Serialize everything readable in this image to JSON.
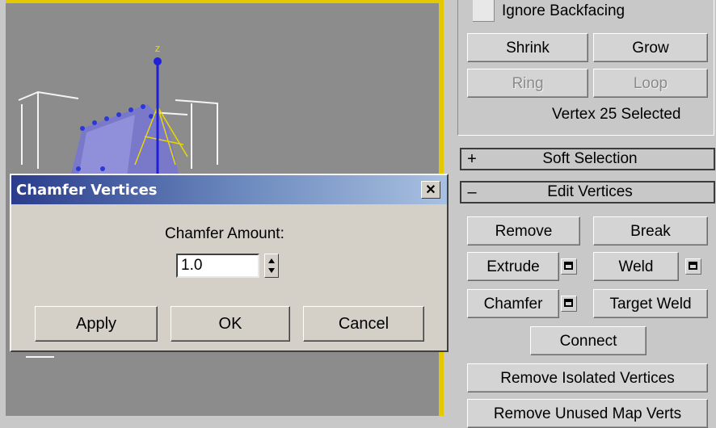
{
  "viewport": {
    "axis_label": "z"
  },
  "panel": {
    "ignore_backfacing_label": "Ignore Backfacing",
    "selection": {
      "shrink": "Shrink",
      "grow": "Grow",
      "ring": "Ring",
      "loop": "Loop",
      "status": "Vertex 25 Selected"
    },
    "rollouts": [
      {
        "sign": "+",
        "title": "Soft Selection"
      },
      {
        "sign": "–",
        "title": "Edit Vertices"
      }
    ],
    "edit_vertices": {
      "remove": "Remove",
      "break": "Break",
      "extrude": "Extrude",
      "weld": "Weld",
      "chamfer": "Chamfer",
      "target_weld": "Target Weld",
      "connect": "Connect",
      "remove_isolated": "Remove Isolated Vertices",
      "remove_unused": "Remove Unused Map Verts"
    }
  },
  "dialog": {
    "title": "Chamfer Vertices",
    "close_glyph": "✕",
    "field_label": "Chamfer Amount:",
    "field_value": "1.0",
    "apply": "Apply",
    "ok": "OK",
    "cancel": "Cancel"
  },
  "colors": {
    "viewport_bg": "#8c8c8c",
    "active_viewport_border": "#e4c800",
    "panel_bg": "#c8c8c8",
    "dialog_title_start": "#2a3c8c",
    "dialog_title_end": "#a8c0e0"
  }
}
